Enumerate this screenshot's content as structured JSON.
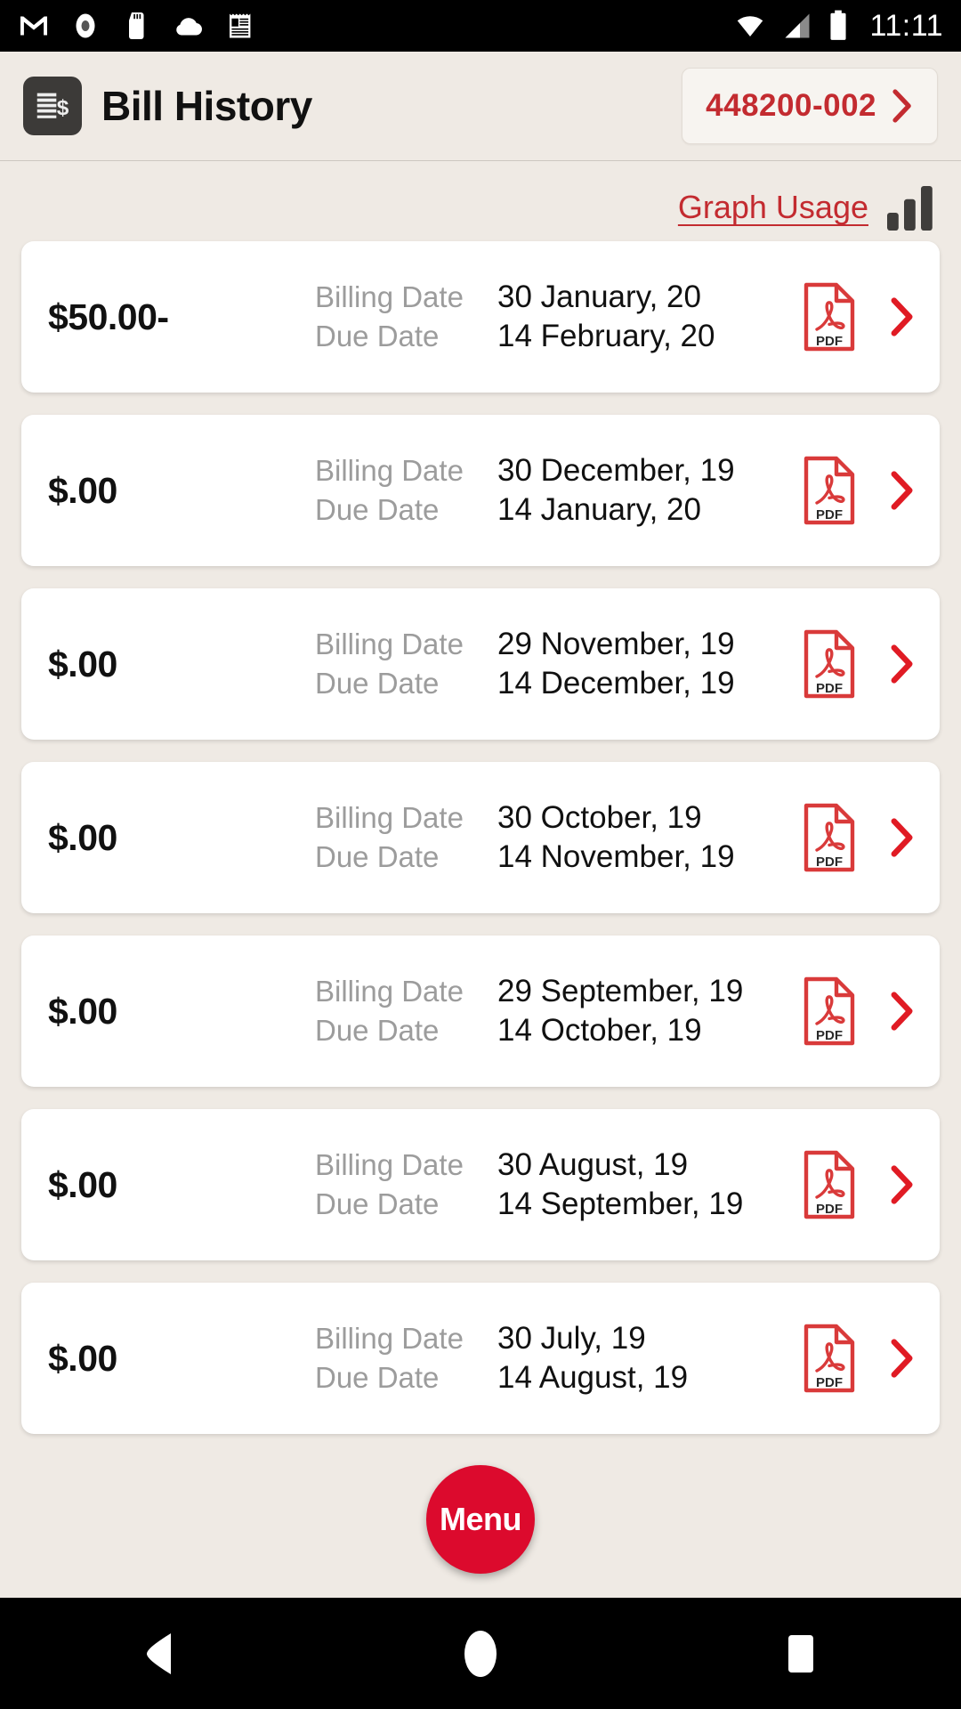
{
  "statusbar": {
    "time": "11:11",
    "left_icons": [
      "gmail-icon",
      "record-icon",
      "sd-card-icon",
      "cloud-icon",
      "news-icon"
    ],
    "right_icons": [
      "wifi-icon",
      "cellular-signal-icon",
      "battery-icon"
    ]
  },
  "header": {
    "icon": "bill-document-icon",
    "title": "Bill History",
    "account": {
      "number": "448200-002",
      "chevron": "chevron-right-icon"
    }
  },
  "toolbar": {
    "graph_usage_label": "Graph Usage",
    "graph_icon": "bar-chart-icon"
  },
  "labels": {
    "billing_date": "Billing Date",
    "due_date": "Due Date",
    "pdf_badge": "PDF",
    "pdf_icon": "pdf-file-icon",
    "row_chevron": "chevron-right-icon"
  },
  "bills": [
    {
      "amount": "$50.00-",
      "billing_date": "30 January, 20",
      "due_date": "14 February, 20"
    },
    {
      "amount": "$.00",
      "billing_date": "30 December, 19",
      "due_date": "14 January, 20"
    },
    {
      "amount": "$.00",
      "billing_date": "29 November, 19",
      "due_date": "14 December, 19"
    },
    {
      "amount": "$.00",
      "billing_date": "30 October, 19",
      "due_date": "14 November, 19"
    },
    {
      "amount": "$.00",
      "billing_date": "29 September, 19",
      "due_date": "14 October, 19"
    },
    {
      "amount": "$.00",
      "billing_date": "30 August, 19",
      "due_date": "14 September, 19"
    },
    {
      "amount": "$.00",
      "billing_date": "30 July, 19",
      "due_date": "14 August, 19"
    }
  ],
  "fab": {
    "label": "Menu"
  },
  "navbar": {
    "back": "back-triangle-icon",
    "home": "home-circle-icon",
    "recents": "recents-square-icon"
  },
  "colors": {
    "brand_red": "#C32B30",
    "fab_red": "#DC0A2D",
    "background": "#EFEAE4",
    "card": "#FFFFFF",
    "label_gray": "#9C9C9C",
    "icon_dark": "#3C3A38"
  }
}
